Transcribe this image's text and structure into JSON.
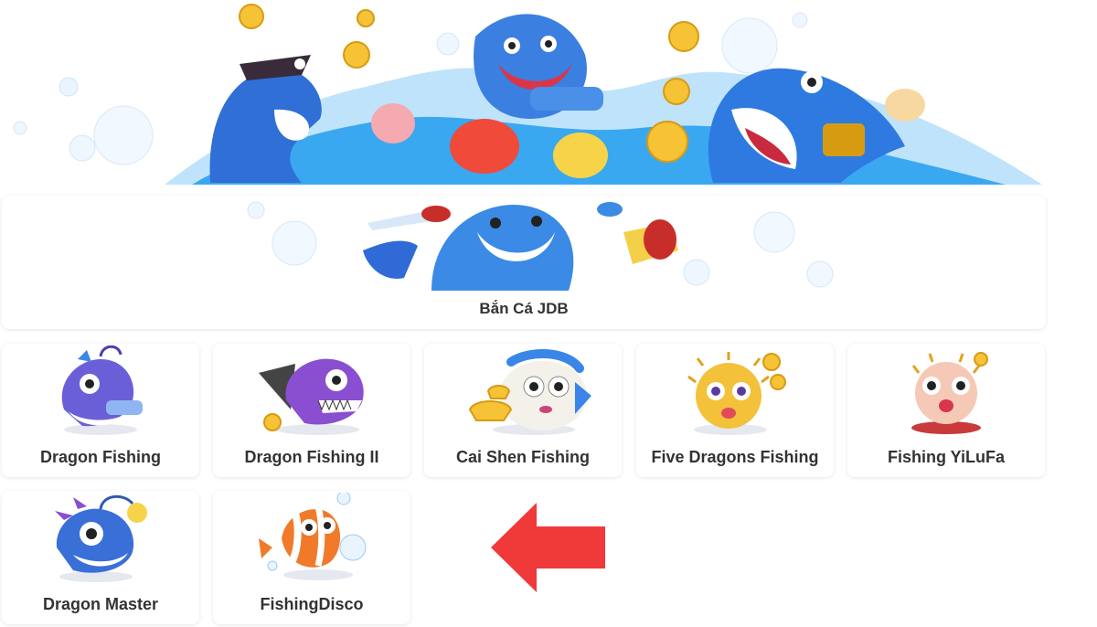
{
  "colors": {
    "arrow": "#f03a3a",
    "title_text": "#333333",
    "card_bg": "#ffffff",
    "wave": "#3aa8f0"
  },
  "banner": {
    "title": "Bắn Cá JDB",
    "image_icon": "shark-rockets-icon"
  },
  "games": [
    {
      "title": "Dragon Fishing",
      "icon": "anglerfish-cannon-icon"
    },
    {
      "title": "Dragon Fishing II",
      "icon": "purple-anglerfish-icon"
    },
    {
      "title": "Cai Shen Fishing",
      "icon": "pufferfish-gold-icon"
    },
    {
      "title": "Five Dragons Fishing",
      "icon": "yellow-pufferfish-icon"
    },
    {
      "title": "Fishing YiLuFa",
      "icon": "pink-pufferfish-icon"
    },
    {
      "title": "Dragon Master",
      "icon": "blue-anglerfish-icon"
    },
    {
      "title": "FishingDisco",
      "icon": "clownfish-icon"
    }
  ],
  "pointer": {
    "icon": "red-left-arrow-icon"
  }
}
